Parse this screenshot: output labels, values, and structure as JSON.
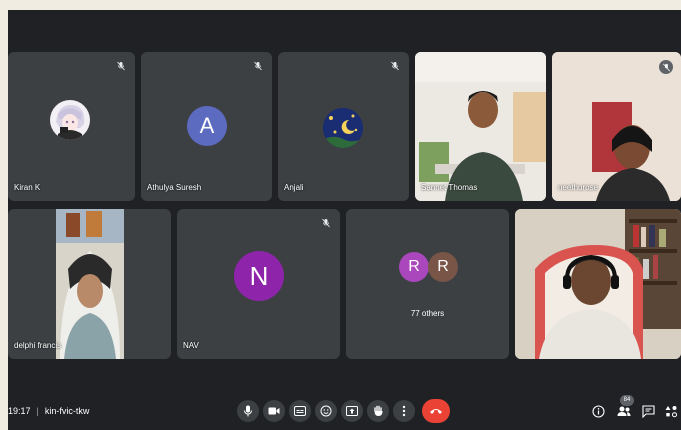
{
  "participants": [
    {
      "name": "Kiran K"
    },
    {
      "name": "Athulya Suresh",
      "initial": "A"
    },
    {
      "name": "Anjali"
    },
    {
      "name": "Sannet Thomas"
    },
    {
      "name": "neethurose"
    },
    {
      "name": "delphi francis"
    },
    {
      "name": "NAV",
      "initial": "N"
    },
    {
      "initials": [
        "R",
        "R"
      ],
      "others_label": "77 others"
    },
    {
      "name": ""
    }
  ],
  "meeting": {
    "time": "19:17",
    "separator": "|",
    "code": "kin-fvic-tkw"
  },
  "people_count": "84",
  "colors": {
    "background": "#202124",
    "tile": "#3c4043",
    "avatar_athulya": "#5c6bc0",
    "avatar_nav": "#8e24aa",
    "avatar_r1": "#ab47bc",
    "avatar_r2": "#795548",
    "leave": "#ea4335"
  },
  "controls": {
    "center": [
      "microphone-icon",
      "camera-icon",
      "captions-icon",
      "emoji-icon",
      "present-icon",
      "raise-hand-icon",
      "more-options-icon",
      "leave-call-icon"
    ],
    "right": [
      "info-icon",
      "people-icon",
      "chat-icon",
      "activities-icon"
    ]
  }
}
